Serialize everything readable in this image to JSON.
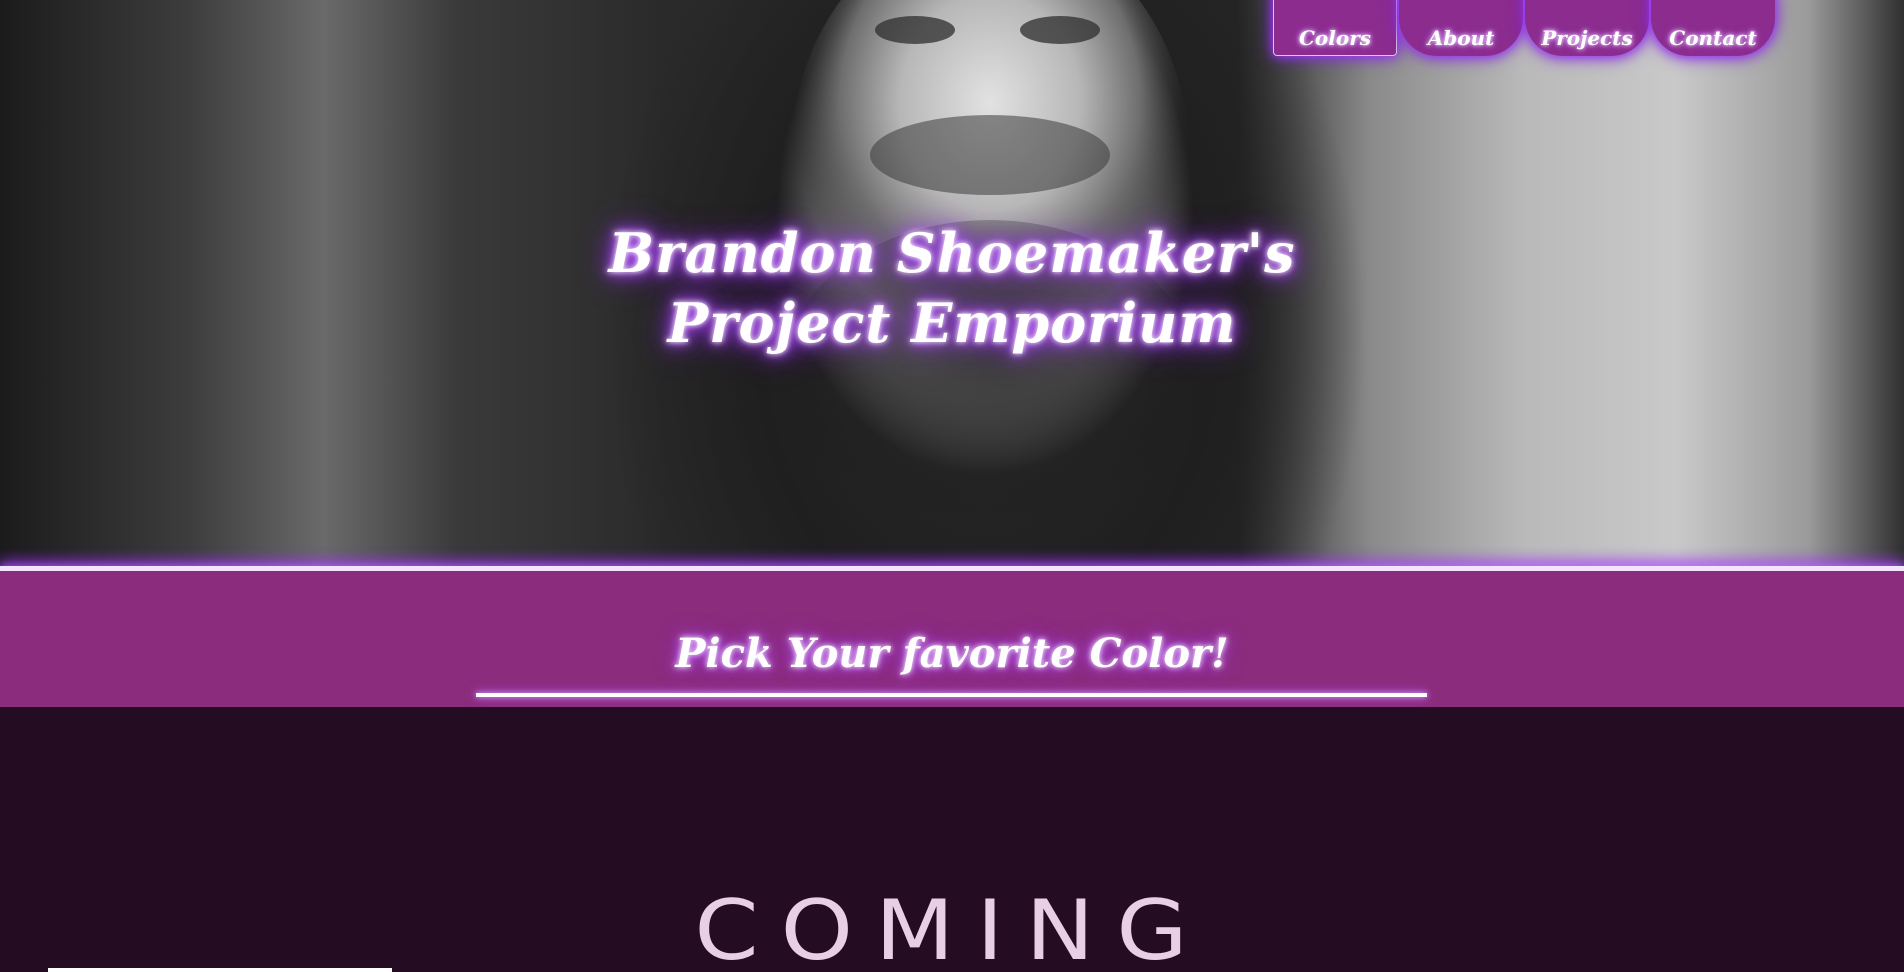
{
  "hero": {
    "title_line1": "Brandon Shoemaker's",
    "title_line2": "Project Emporium"
  },
  "nav": {
    "items": [
      {
        "label": "Colors",
        "active": true
      },
      {
        "label": "About",
        "active": false
      },
      {
        "label": "Projects",
        "active": false
      },
      {
        "label": "Contact",
        "active": false
      }
    ]
  },
  "banner": {
    "heading": "Pick Your favorite Color!"
  },
  "lower": {
    "coming_text": "COMING"
  },
  "colors": {
    "nav_bg": "#8b2c8e",
    "banner_bg": "#8b2c7c",
    "lower_bg": "#240d22",
    "glow": "#9b30ff"
  }
}
